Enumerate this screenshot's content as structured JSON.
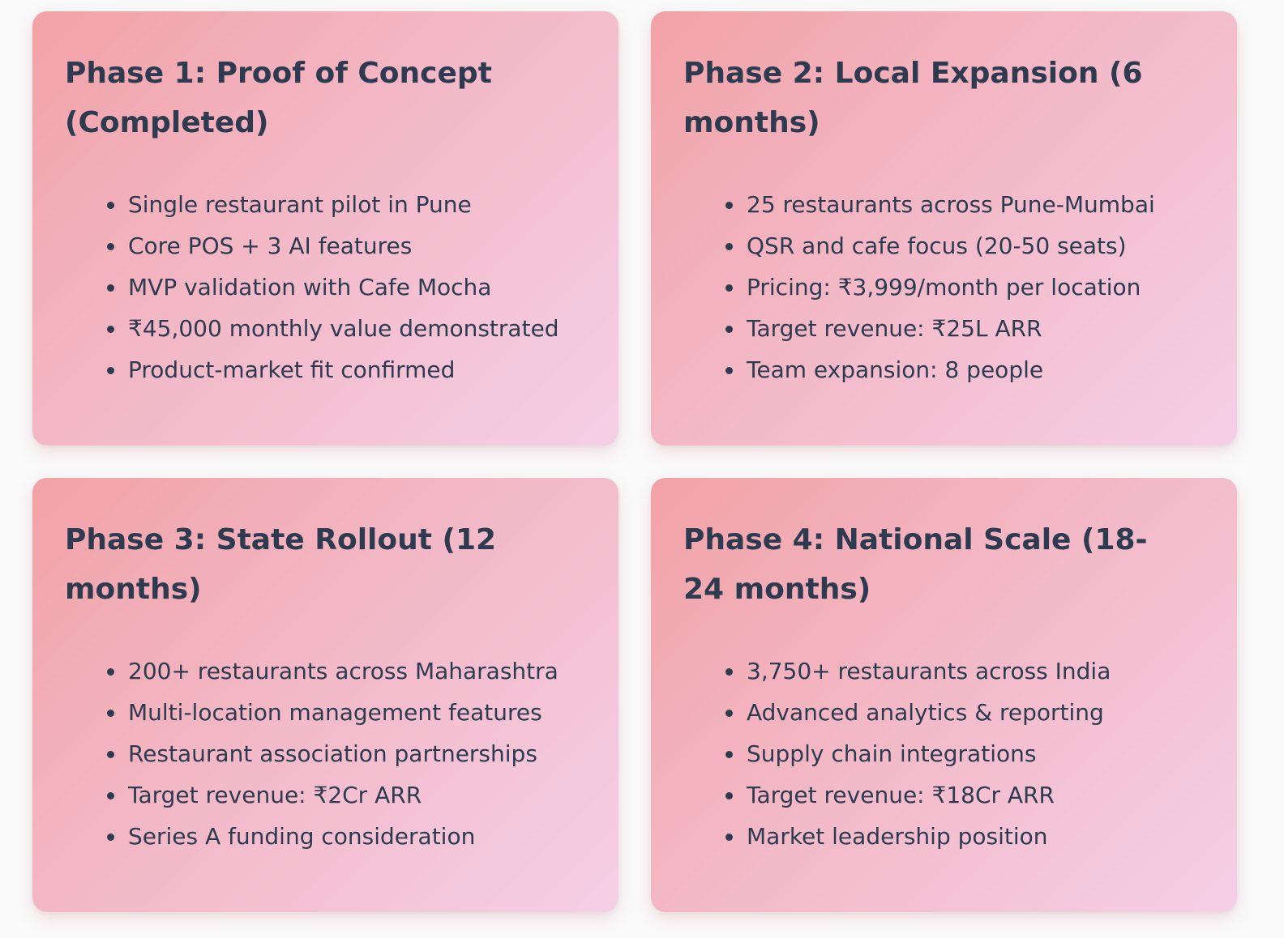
{
  "phases": [
    {
      "title": "Phase 1: Proof of Concept (Completed)",
      "items": [
        "Single restaurant pilot in Pune",
        "Core POS + 3 AI features",
        "MVP validation with Cafe Mocha",
        "₹45,000 monthly value demonstrated",
        "Product-market fit confirmed"
      ]
    },
    {
      "title": "Phase 2: Local Expansion (6 months)",
      "items": [
        "25 restaurants across Pune-Mumbai",
        "QSR and cafe focus (20-50 seats)",
        "Pricing: ₹3,999/month per location",
        "Target revenue: ₹25L ARR",
        "Team expansion: 8 people"
      ]
    },
    {
      "title": "Phase 3: State Rollout (12 months)",
      "items": [
        "200+ restaurants across Maharashtra",
        "Multi-location management features",
        "Restaurant association partnerships",
        "Target revenue: ₹2Cr ARR",
        "Series A funding consideration"
      ]
    },
    {
      "title": "Phase 4: National Scale (18-24 months)",
      "items": [
        "3,750+ restaurants across India",
        "Advanced analytics & reporting",
        "Supply chain integrations",
        "Target revenue: ₹18Cr ARR",
        "Market leadership position"
      ]
    }
  ],
  "colors": {
    "text": "#2e3a4f",
    "card_gradient_start": "#f2a2a6",
    "card_gradient_end": "#f5cfe6",
    "background": "#fafafa"
  }
}
